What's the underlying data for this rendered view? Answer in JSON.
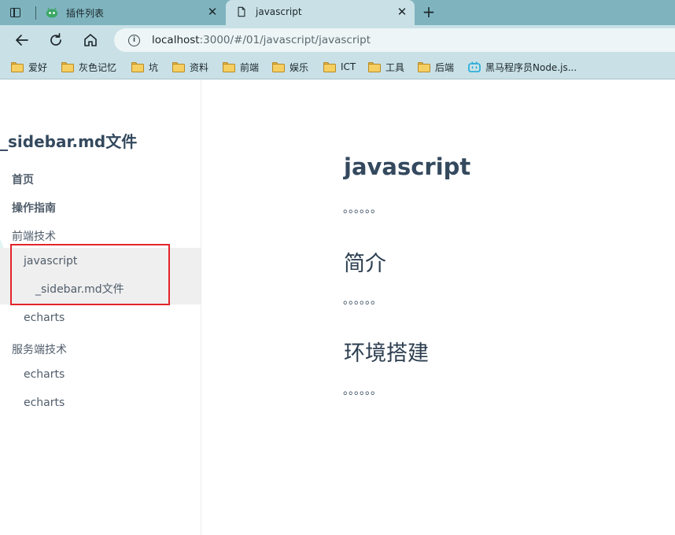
{
  "browser": {
    "tabs": [
      {
        "title": "插件列表",
        "icon": "extension-icon"
      },
      {
        "title": "javascript",
        "icon": "document-icon"
      }
    ],
    "url_host": "localhost",
    "url_rest": ":3000/#/01/javascript/javascript",
    "bookmarks": [
      {
        "label": "爱好",
        "icon": "folder-icon"
      },
      {
        "label": "灰色记忆",
        "icon": "folder-icon"
      },
      {
        "label": "坑",
        "icon": "folder-icon"
      },
      {
        "label": "资料",
        "icon": "folder-icon"
      },
      {
        "label": "前端",
        "icon": "folder-icon"
      },
      {
        "label": "娱乐",
        "icon": "folder-icon"
      },
      {
        "label": "ICT",
        "icon": "folder-icon"
      },
      {
        "label": "工具",
        "icon": "folder-icon"
      },
      {
        "label": "后端",
        "icon": "folder-icon"
      },
      {
        "label": "黑马程序员Node.js...",
        "icon": "bilibili-icon"
      }
    ]
  },
  "sidebar": {
    "app_name": "_sidebar.md文件",
    "items": [
      {
        "label": "首页"
      },
      {
        "label": "操作指南"
      },
      {
        "label": "前端技术"
      },
      {
        "label": "javascript"
      },
      {
        "label": "_sidebar.md文件"
      },
      {
        "label": "echarts"
      },
      {
        "label": "服务端技术"
      },
      {
        "label": "echarts"
      },
      {
        "label": "echarts"
      }
    ]
  },
  "main": {
    "title": "javascript",
    "sections": [
      {
        "text": "。。。。。。"
      },
      {
        "heading": "简介",
        "text": "。。。。。。"
      },
      {
        "heading": "环境搭建",
        "text": "。。。。。。"
      }
    ]
  },
  "colors": {
    "tab_strip": "#7fb4bf",
    "toolbar": "#c9e1e6",
    "highlight_box": "#e3242b",
    "active_band": "#efefef"
  }
}
